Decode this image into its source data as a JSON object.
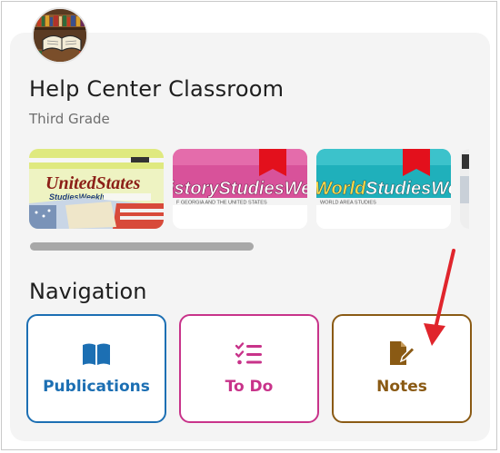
{
  "classroom": {
    "title": "Help Center Classroom",
    "subtitle": "Third Grade"
  },
  "publications": [
    {
      "name": "The United States Studies Weekly",
      "cover_color": "#e6ef9a",
      "bookmarked": false
    },
    {
      "name": "Georgia History Studies Weekly",
      "cover_color": "#d4488e",
      "bookmarked": true
    },
    {
      "name": "World Studies Weekly",
      "cover_color": "#22b0b9",
      "bookmarked": true
    }
  ],
  "navigation": {
    "heading": "Navigation",
    "items": [
      {
        "label": "Publications",
        "icon": "book-open-icon",
        "color": "#1c6fb3"
      },
      {
        "label": "To Do",
        "icon": "checklist-icon",
        "color": "#c8338a"
      },
      {
        "label": "Notes",
        "icon": "note-pen-icon",
        "color": "#8a5a14"
      }
    ]
  },
  "colors": {
    "annotation_arrow": "#e0252c"
  }
}
